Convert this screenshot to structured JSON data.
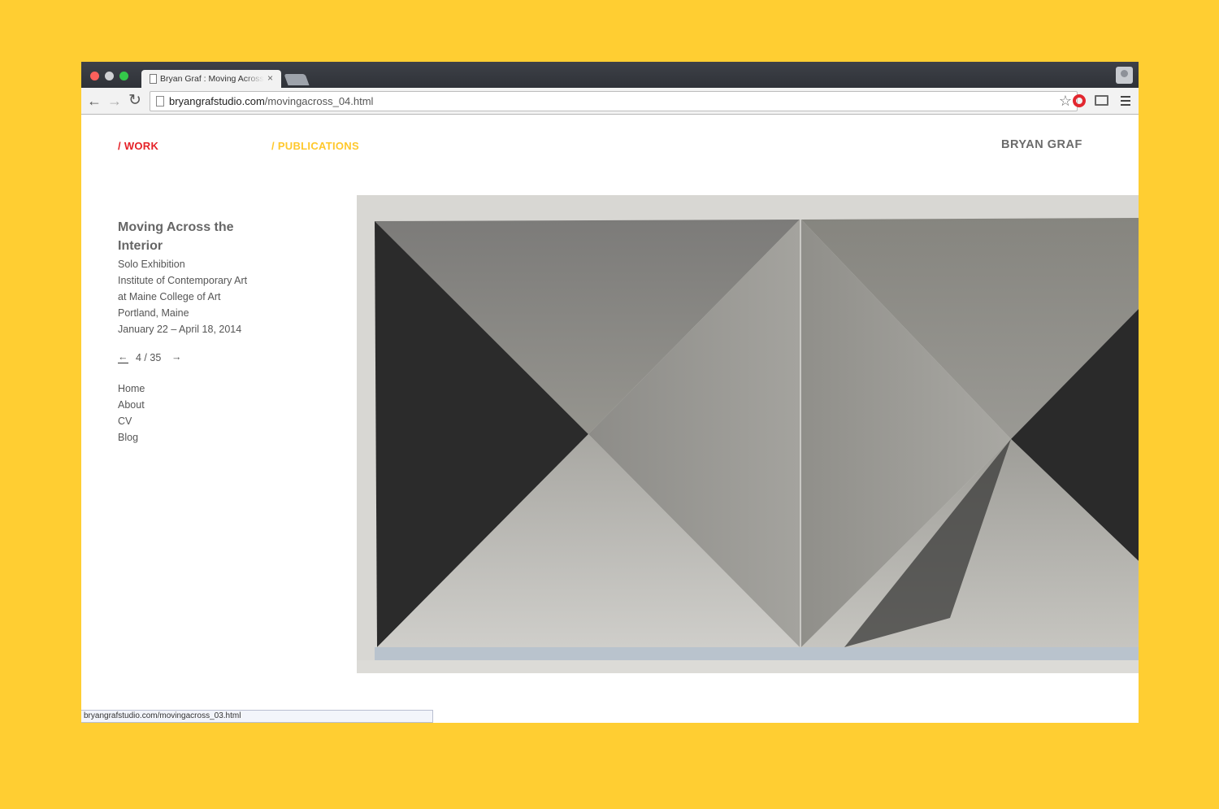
{
  "browser": {
    "tab_title": "Bryan Graf : Moving Across the Interior",
    "tab_close": "×",
    "url_host": "bryangrafstudio.com",
    "url_path": "/movingacross_04.html",
    "status_url": "bryangrafstudio.com/movingacross_03.html",
    "icons": [
      "back-arrow-icon",
      "forward-arrow-icon",
      "reload-icon",
      "page-icon",
      "star-icon",
      "opera-icon",
      "cast-icon",
      "menu-icon"
    ]
  },
  "site": {
    "nav": {
      "work": "/ WORK",
      "publications": "/ PUBLICATIONS"
    },
    "name": "BRYAN GRAF",
    "colors": {
      "work": "#e52228",
      "publications": "#ffc82c",
      "background": "#FFCE32"
    }
  },
  "project": {
    "title": "Moving Across the Interior",
    "lines": [
      "Solo Exhibition",
      "Institute of Contemporary Art",
      "at Maine College of Art",
      "Portland, Maine",
      "January 22 – April 18, 2014"
    ]
  },
  "pager": {
    "prev": "←",
    "count": "4 / 35",
    "next": "→",
    "current": 4,
    "total": 35
  },
  "links": [
    "Home",
    "About",
    "CV",
    "Blog"
  ]
}
